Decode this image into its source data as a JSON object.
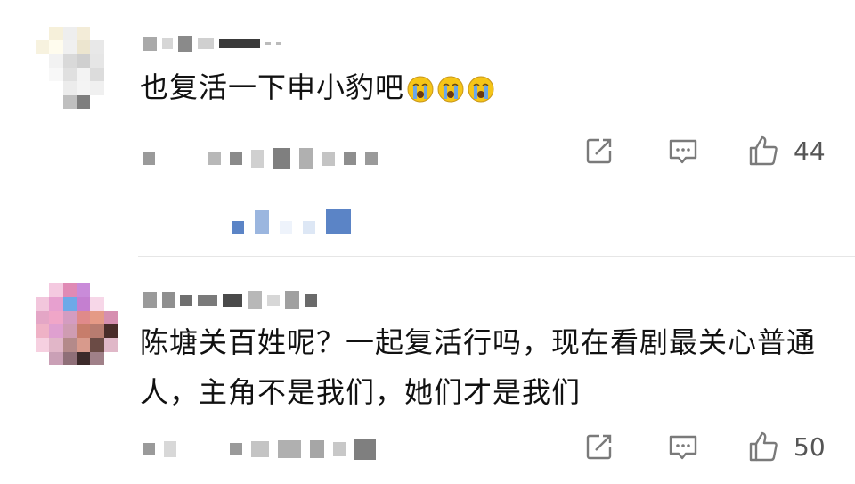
{
  "comments": [
    {
      "text": "也复活一下申小豹吧",
      "emoji": [
        "crying-face",
        "crying-face",
        "crying-face"
      ],
      "likes": "44"
    },
    {
      "text": "陈塘关百姓呢？一起复活行吗，现在看剧最关心普通人，主角不是我们，她们才是我们",
      "likes": "50"
    }
  ],
  "colors": {
    "link": "#5b84c6",
    "text": "#111111",
    "icon": "#7a7a7a",
    "emoji": "#f5c518",
    "tear": "#6aa7e8"
  }
}
